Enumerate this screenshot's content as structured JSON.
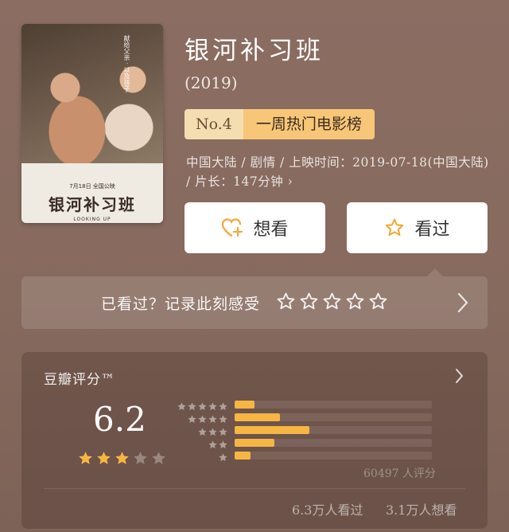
{
  "movie": {
    "title": "银河补习班",
    "year": "(2019)",
    "rank_no": "No.4",
    "rank_label": "一周热门电影榜",
    "meta": "中国大陆 / 剧情 / 上映时间：2019-07-18(中国大陆) / 片长：147分钟 ›"
  },
  "poster": {
    "release_text": "7月18日 全国公映",
    "title": "银河补习班",
    "english": "LOOKING UP",
    "vertical_text": "献给父亲 · 以及孩子"
  },
  "actions": {
    "want_label": "想看",
    "seen_label": "看过"
  },
  "record": {
    "prompt": "已看过？记录此刻感受",
    "star_count": 5
  },
  "rating": {
    "title": "豆瓣评分™",
    "score": "6.2",
    "stars_filled": 3,
    "stars_total": 5,
    "distribution": [
      {
        "stars": 5,
        "fraction": 0.1
      },
      {
        "stars": 4,
        "fraction": 0.23
      },
      {
        "stars": 3,
        "fraction": 0.38
      },
      {
        "stars": 2,
        "fraction": 0.2
      },
      {
        "stars": 1,
        "fraction": 0.08
      }
    ],
    "count_text": "60497 人评分",
    "seen_text": "6.3万人看过",
    "want_text": "3.1万人想看"
  },
  "colors": {
    "accent": "#f5b643",
    "badge_light": "#f4ddb0",
    "badge_dark": "#f7c678",
    "background": "#8a6c60"
  }
}
